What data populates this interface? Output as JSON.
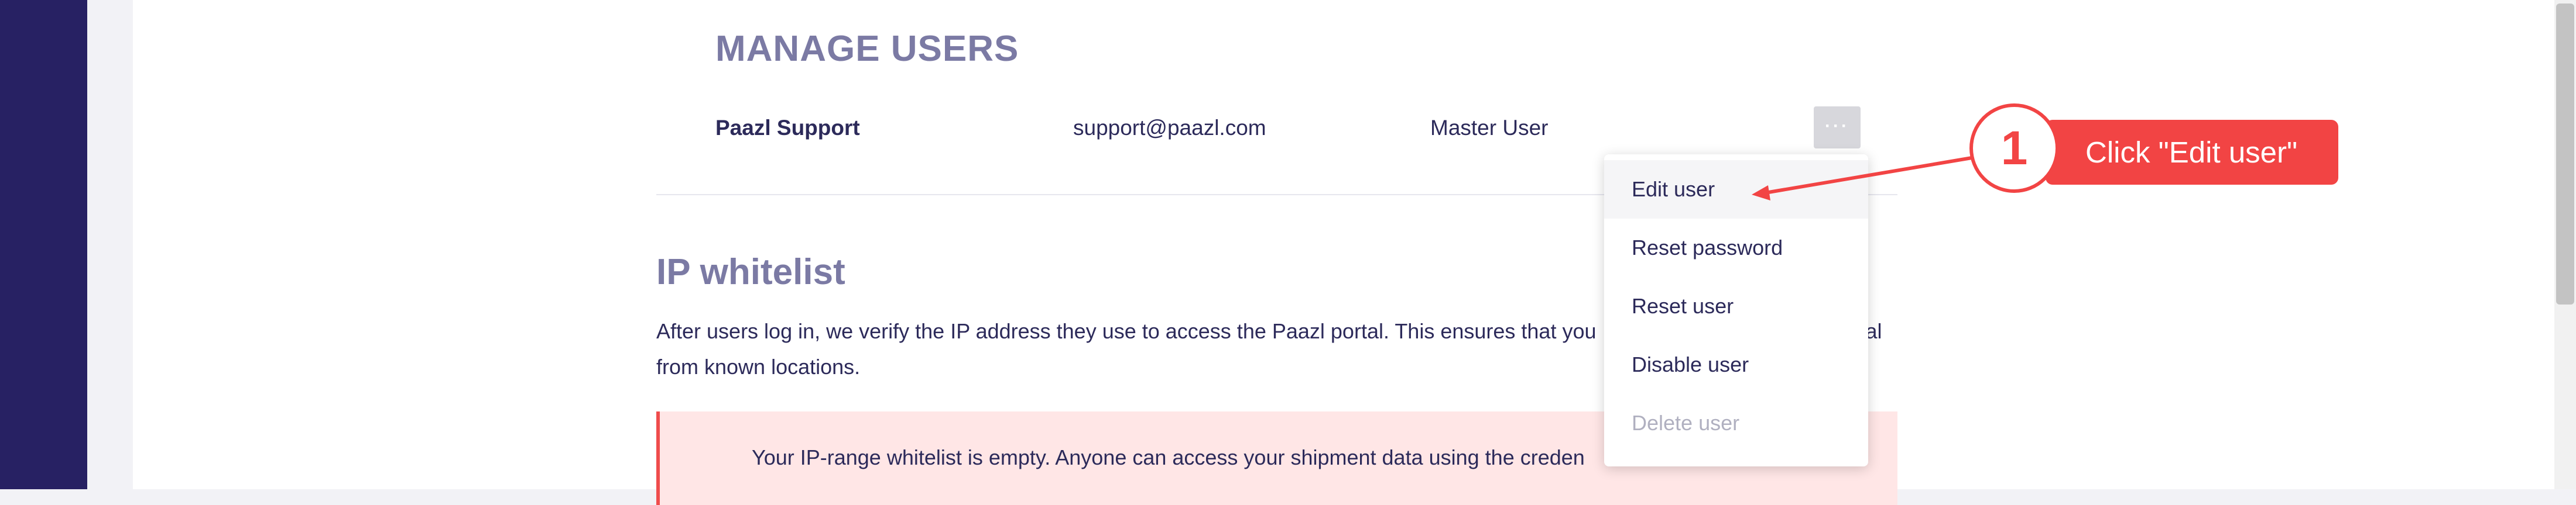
{
  "manage_users": {
    "title": "MANAGE USERS",
    "user_row": {
      "name": "Paazl Support",
      "email": "support@paazl.com",
      "role": "Master User"
    },
    "more_button": {
      "icon": "more-horizontal-icon",
      "label": "···"
    }
  },
  "ip_whitelist": {
    "title": "IP whitelist",
    "description": "After users log in, we verify the IP address they use to access the Paazl portal. This ensures that you",
    "description_tail": "tal",
    "description_line2": "from known locations.",
    "alert_text": "Your IP-range whitelist is empty. Anyone can access your shipment data using the creden"
  },
  "user_menu": {
    "items": [
      {
        "label": "Edit user",
        "state": "hover"
      },
      {
        "label": "Reset password",
        "state": "normal"
      },
      {
        "label": "Reset user",
        "state": "normal"
      },
      {
        "label": "Disable user",
        "state": "normal"
      },
      {
        "label": "Delete user",
        "state": "disabled"
      }
    ]
  },
  "tutorial_callout": {
    "step": "1",
    "text": "Click \"Edit user\""
  },
  "colors": {
    "sidebar": "#272163",
    "heading": "#7b7aa4",
    "text": "#2c2a5a",
    "callout": "#f24444",
    "alert_bg": "#ffe6e6",
    "alert_border": "#ef4c4c"
  }
}
